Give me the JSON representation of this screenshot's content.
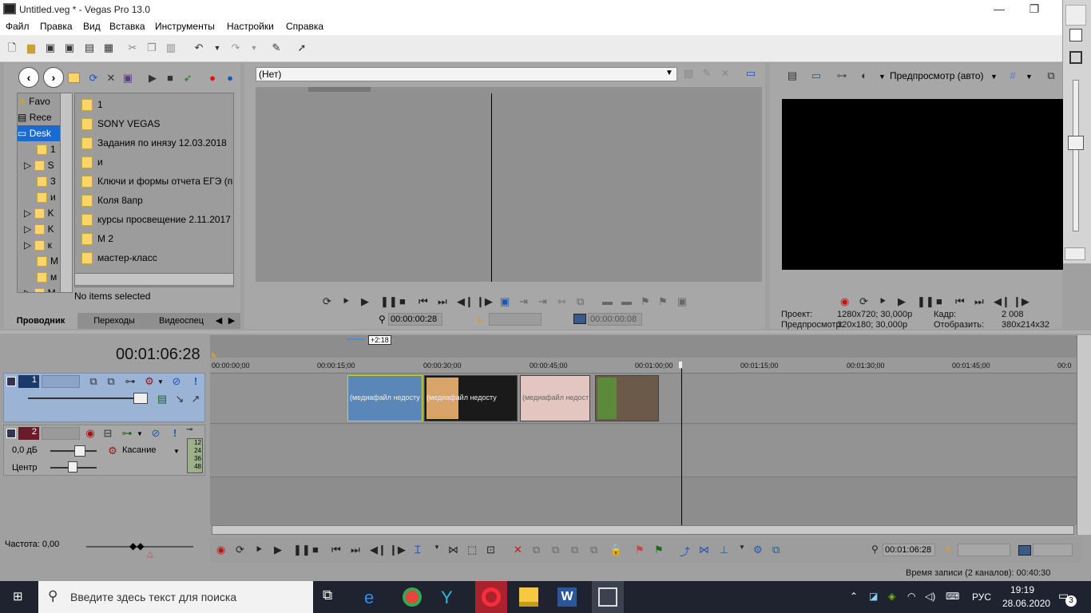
{
  "window": {
    "title": "Untitled.veg * - Vegas Pro 13.0"
  },
  "menu": [
    "Файл",
    "Правка",
    "Вид",
    "Вставка",
    "Инструменты",
    "Настройки",
    "Справка"
  ],
  "explorer": {
    "tree": [
      "Favo",
      "Rece",
      "Desk",
      "1",
      "S",
      "3",
      "и",
      "K",
      "K",
      "к",
      "М",
      "м",
      "М"
    ],
    "files": [
      "1",
      "SONY VEGAS",
      "Задания по инязу 12.03.2018",
      "и",
      "Ключи и формы отчета ЕГЭ (пр",
      "Коля 8апр",
      "курсы просвещение 2.11.2017",
      "М 2",
      "мастер-класс"
    ],
    "status": "No items selected",
    "tabs": [
      "Проводник",
      "Переходы",
      "Видеоспец"
    ]
  },
  "trimmer": {
    "combo": "(Нет)",
    "tc_in": "00:00:00:28",
    "tc_len": "00:00:00:08"
  },
  "preview": {
    "mode": "Предпросмотр (авто)",
    "project_label": "Проект:",
    "project_value": "1280x720; 30,000p",
    "preview_label": "Предпросмотр:",
    "preview_value": "320x180; 30,000p",
    "frame_label": "Кадр:",
    "frame_value": "2 008",
    "display_label": "Отобразить:",
    "display_value": "380x214x32"
  },
  "tracks": {
    "timecode": "00:01:06:28",
    "rate_badge": "+2:18",
    "track1_num": "1",
    "track2_num": "2",
    "volume": "0,0 дБ",
    "pan": "Центр",
    "mode": "Касание",
    "meter": [
      "12",
      "24",
      "36",
      "48"
    ],
    "freq": "Частота: 0,00"
  },
  "ruler": [
    "00:00:00;00",
    "00:00:15;00",
    "00:00:30;00",
    "00:00:45;00",
    "00:01:00;00",
    "00:01:15;00",
    "00:01:30;00",
    "00:01:45;00",
    "00:0"
  ],
  "clips": [
    {
      "label": "(медиафайл недосту",
      "color": "#5a86b8"
    },
    {
      "label": "(медиафайл недосту",
      "color": "#1a1a1a"
    },
    {
      "label": "(медиафайл недост",
      "color": "#e4c6c0"
    },
    {
      "label": "",
      "color": "#6b5a4a"
    }
  ],
  "bottom": {
    "timecode": "00:01:06:28",
    "record_time": "Время записи (2 каналов): 00:40:30"
  },
  "taskbar": {
    "search": "Введите здесь текст для поиска",
    "lang": "РУС",
    "time": "19:19",
    "date": "28.06.2020",
    "badge": "3"
  }
}
